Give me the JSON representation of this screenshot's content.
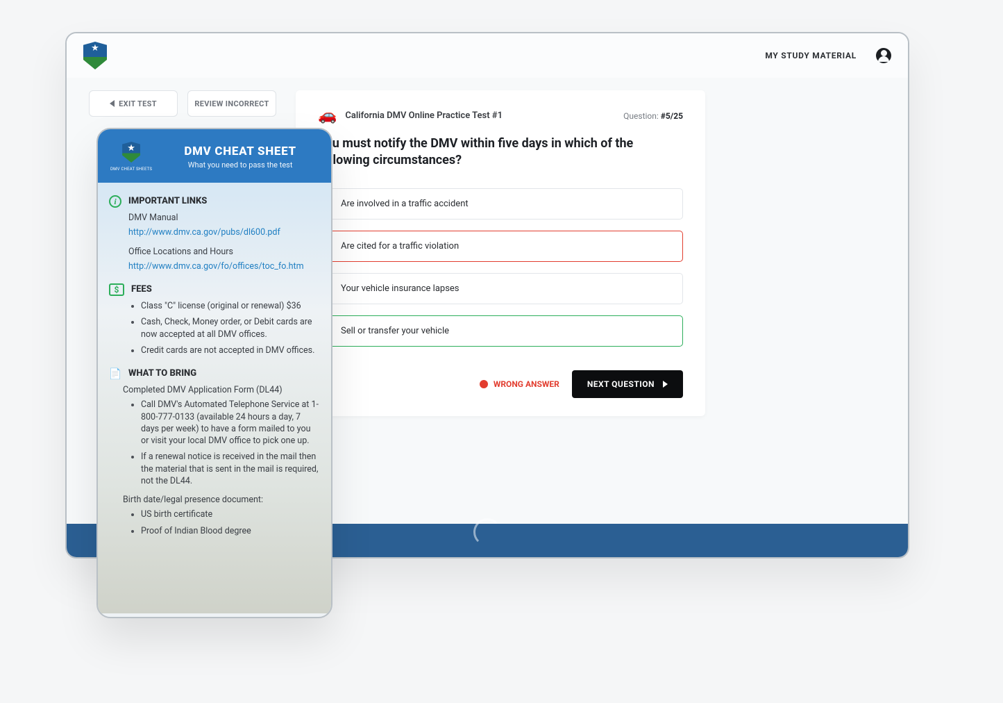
{
  "header": {
    "study_link": "MY STUDY MATERIAL"
  },
  "left_bar": {
    "exit_label": "EXIT TEST",
    "review_label": "REVIEW INCORRECT"
  },
  "quiz": {
    "title": "California DMV Online Practice Test #1",
    "meta_label": "Question:",
    "meta_value": "#5/25",
    "question": "You must notify the DMV within five days in which of the following circumstances?",
    "answers": [
      {
        "text": "Are involved in a traffic accident",
        "state": "none"
      },
      {
        "text": "Are cited for a traffic violation",
        "state": "wrong"
      },
      {
        "text": "Your vehicle insurance lapses",
        "state": "none"
      },
      {
        "text": "Sell or transfer your vehicle",
        "state": "correct"
      }
    ],
    "wrong_label": "WRONG ANSWER",
    "next_label": "NEXT QUESTION"
  },
  "cheat": {
    "logo_sub": "DMV CHEAT SHEETS",
    "title": "DMV CHEAT SHEET",
    "subtitle": "What you need to pass the test",
    "links_head": "IMPORTANT LINKS",
    "links": {
      "manual_label": "DMV Manual",
      "manual_url": "http://www.dmv.ca.gov/pubs/dl600.pdf",
      "office_label": "Office Locations and Hours",
      "office_url": "http://www.dmv.ca.gov/fo/offices/toc_fo.htm"
    },
    "fees_head": "FEES",
    "fees": [
      "Class \"C\" license (original or renewal) $36",
      "Cash, Check, Money order, or Debit cards are now accepted at all DMV offices.",
      "Credit cards are not accepted in DMV offices."
    ],
    "bring_head": "WHAT TO BRING",
    "bring_intro": "Completed DMV Application Form (DL44)",
    "bring": [
      "Call DMV's Automated Telephone Service at 1-800-777-0133 (available 24 hours a day, 7 days per week) to have a form mailed to you or visit your local DMV office to pick one up.",
      "If a renewal notice is received in the mail then the material that is sent in the mail is required, not the DL44."
    ],
    "birth_intro": "Birth date/legal presence document:",
    "birth": [
      "US birth certificate",
      "Proof of Indian Blood degree"
    ]
  }
}
